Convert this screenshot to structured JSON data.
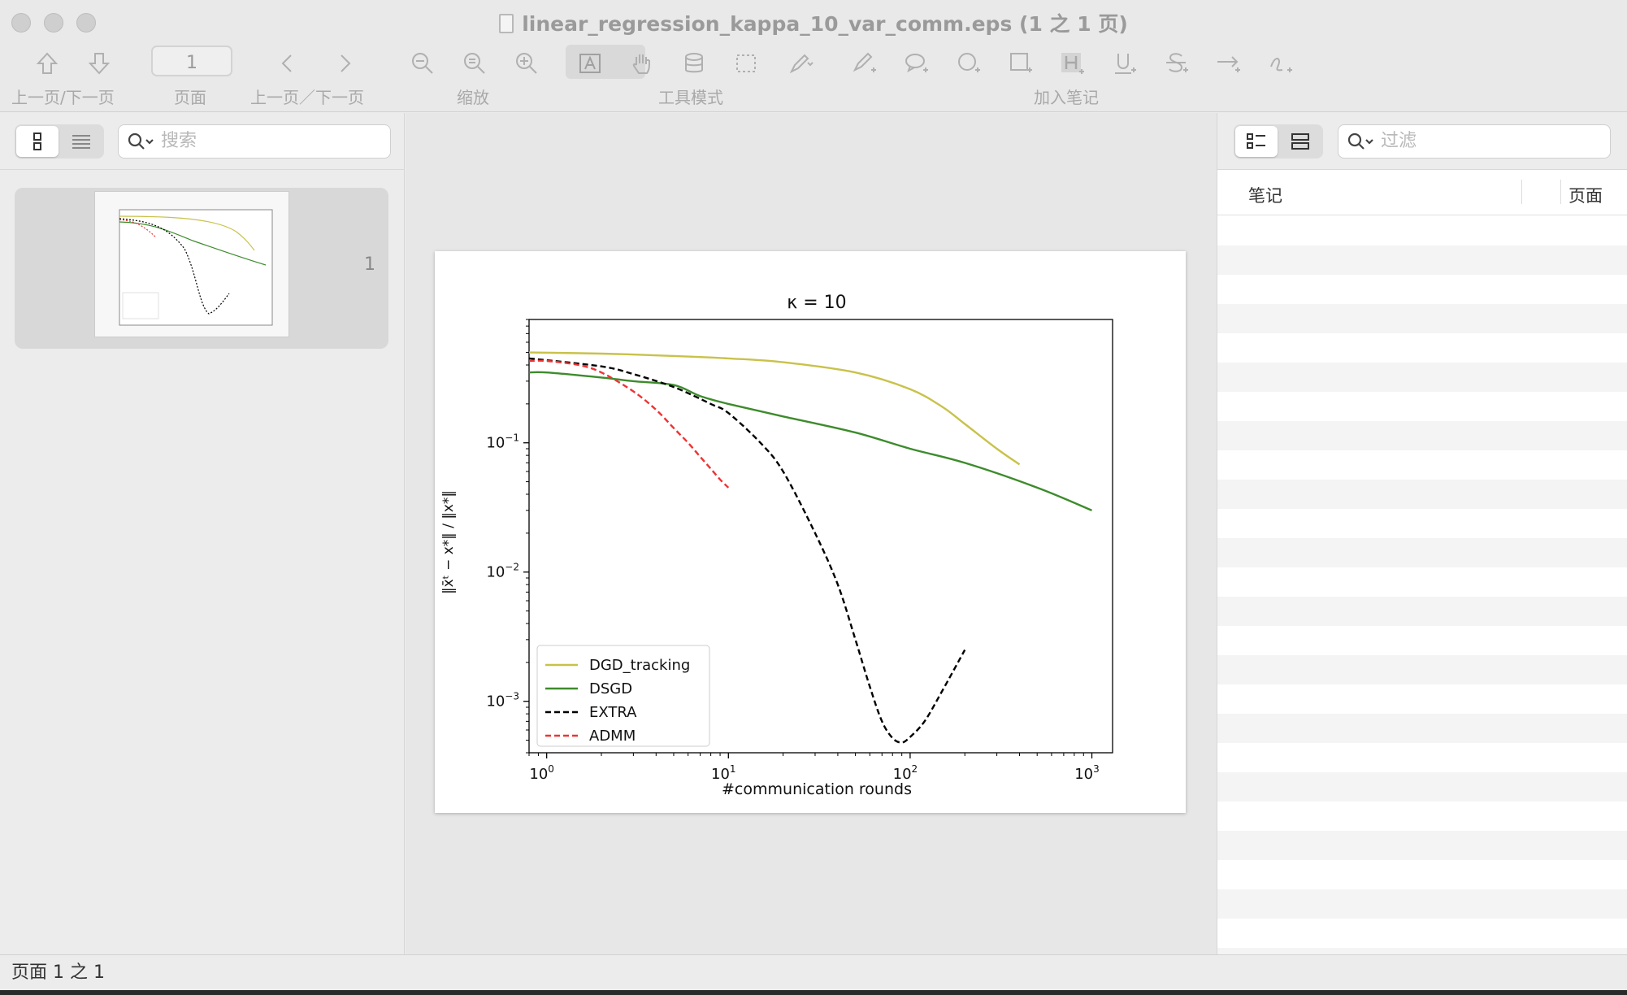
{
  "window": {
    "title": "linear_regression_kappa_10_var_comm.eps (1 之 1 页)"
  },
  "toolbar": {
    "nav_label": "上一页/下一页",
    "page_field_value": "1",
    "page_label": "页面",
    "nav_label2": "上一页／下一页",
    "zoom_label": "缩放",
    "tool_mode_label": "工具模式",
    "annotate_label": "加入笔记"
  },
  "sidebar": {
    "search_placeholder": "搜索",
    "thumbnail_page_number": "1"
  },
  "notes_panel": {
    "search_placeholder": "过滤",
    "col_notes": "笔记",
    "col_page": "页面"
  },
  "status": {
    "text": "页面 1 之 1"
  },
  "colors": {
    "dgd_tracking": "#c8c24a",
    "dsgd": "#3d8b2c",
    "extra": "#000000",
    "admm": "#ee3333"
  },
  "chart_data": {
    "type": "line",
    "title": "κ = 10",
    "xlabel": "#communication rounds",
    "ylabel": "‖x̄ᵗ − x*‖ / ‖x*‖",
    "xscale": "log",
    "yscale": "log",
    "xlim": [
      0.8,
      1300
    ],
    "ylim": [
      0.0004,
      0.9
    ],
    "xticks": [
      {
        "value": 1,
        "base": "10",
        "exp": "0"
      },
      {
        "value": 10,
        "base": "10",
        "exp": "1"
      },
      {
        "value": 100,
        "base": "10",
        "exp": "2"
      },
      {
        "value": 1000,
        "base": "10",
        "exp": "3"
      }
    ],
    "yticks": [
      {
        "value": 0.1,
        "base": "10",
        "exp": "−1"
      },
      {
        "value": 0.01,
        "base": "10",
        "exp": "−2"
      },
      {
        "value": 0.001,
        "base": "10",
        "exp": "−3"
      }
    ],
    "legend_position": "lower-left",
    "series": [
      {
        "name": "DGD_tracking",
        "style": "solid",
        "x": [
          0.8,
          2,
          5,
          10,
          20,
          50,
          100,
          150,
          200,
          300,
          400
        ],
        "y": [
          0.5,
          0.49,
          0.47,
          0.45,
          0.42,
          0.35,
          0.26,
          0.19,
          0.14,
          0.09,
          0.068
        ]
      },
      {
        "name": "DSGD",
        "style": "solid",
        "x": [
          0.8,
          1,
          2,
          3,
          5,
          7,
          10,
          20,
          50,
          100,
          200,
          500,
          1000
        ],
        "y": [
          0.35,
          0.35,
          0.32,
          0.3,
          0.28,
          0.23,
          0.2,
          0.16,
          0.12,
          0.09,
          0.07,
          0.045,
          0.03
        ]
      },
      {
        "name": "EXTRA",
        "style": "dashed",
        "x": [
          0.8,
          2,
          3,
          5,
          8,
          10,
          15,
          20,
          30,
          40,
          50,
          60,
          70,
          80,
          90,
          100,
          120,
          150,
          200
        ],
        "y": [
          0.45,
          0.39,
          0.34,
          0.27,
          0.2,
          0.17,
          0.1,
          0.06,
          0.02,
          0.008,
          0.003,
          0.0013,
          0.0007,
          0.00052,
          0.00048,
          0.00053,
          0.0007,
          0.0012,
          0.0025
        ]
      },
      {
        "name": "ADMM",
        "style": "dashed",
        "x": [
          0.8,
          1,
          1.5,
          2,
          3,
          4,
          5,
          6,
          7,
          8,
          9,
          10
        ],
        "y": [
          0.43,
          0.43,
          0.4,
          0.35,
          0.25,
          0.18,
          0.13,
          0.1,
          0.078,
          0.063,
          0.052,
          0.045
        ]
      }
    ]
  }
}
